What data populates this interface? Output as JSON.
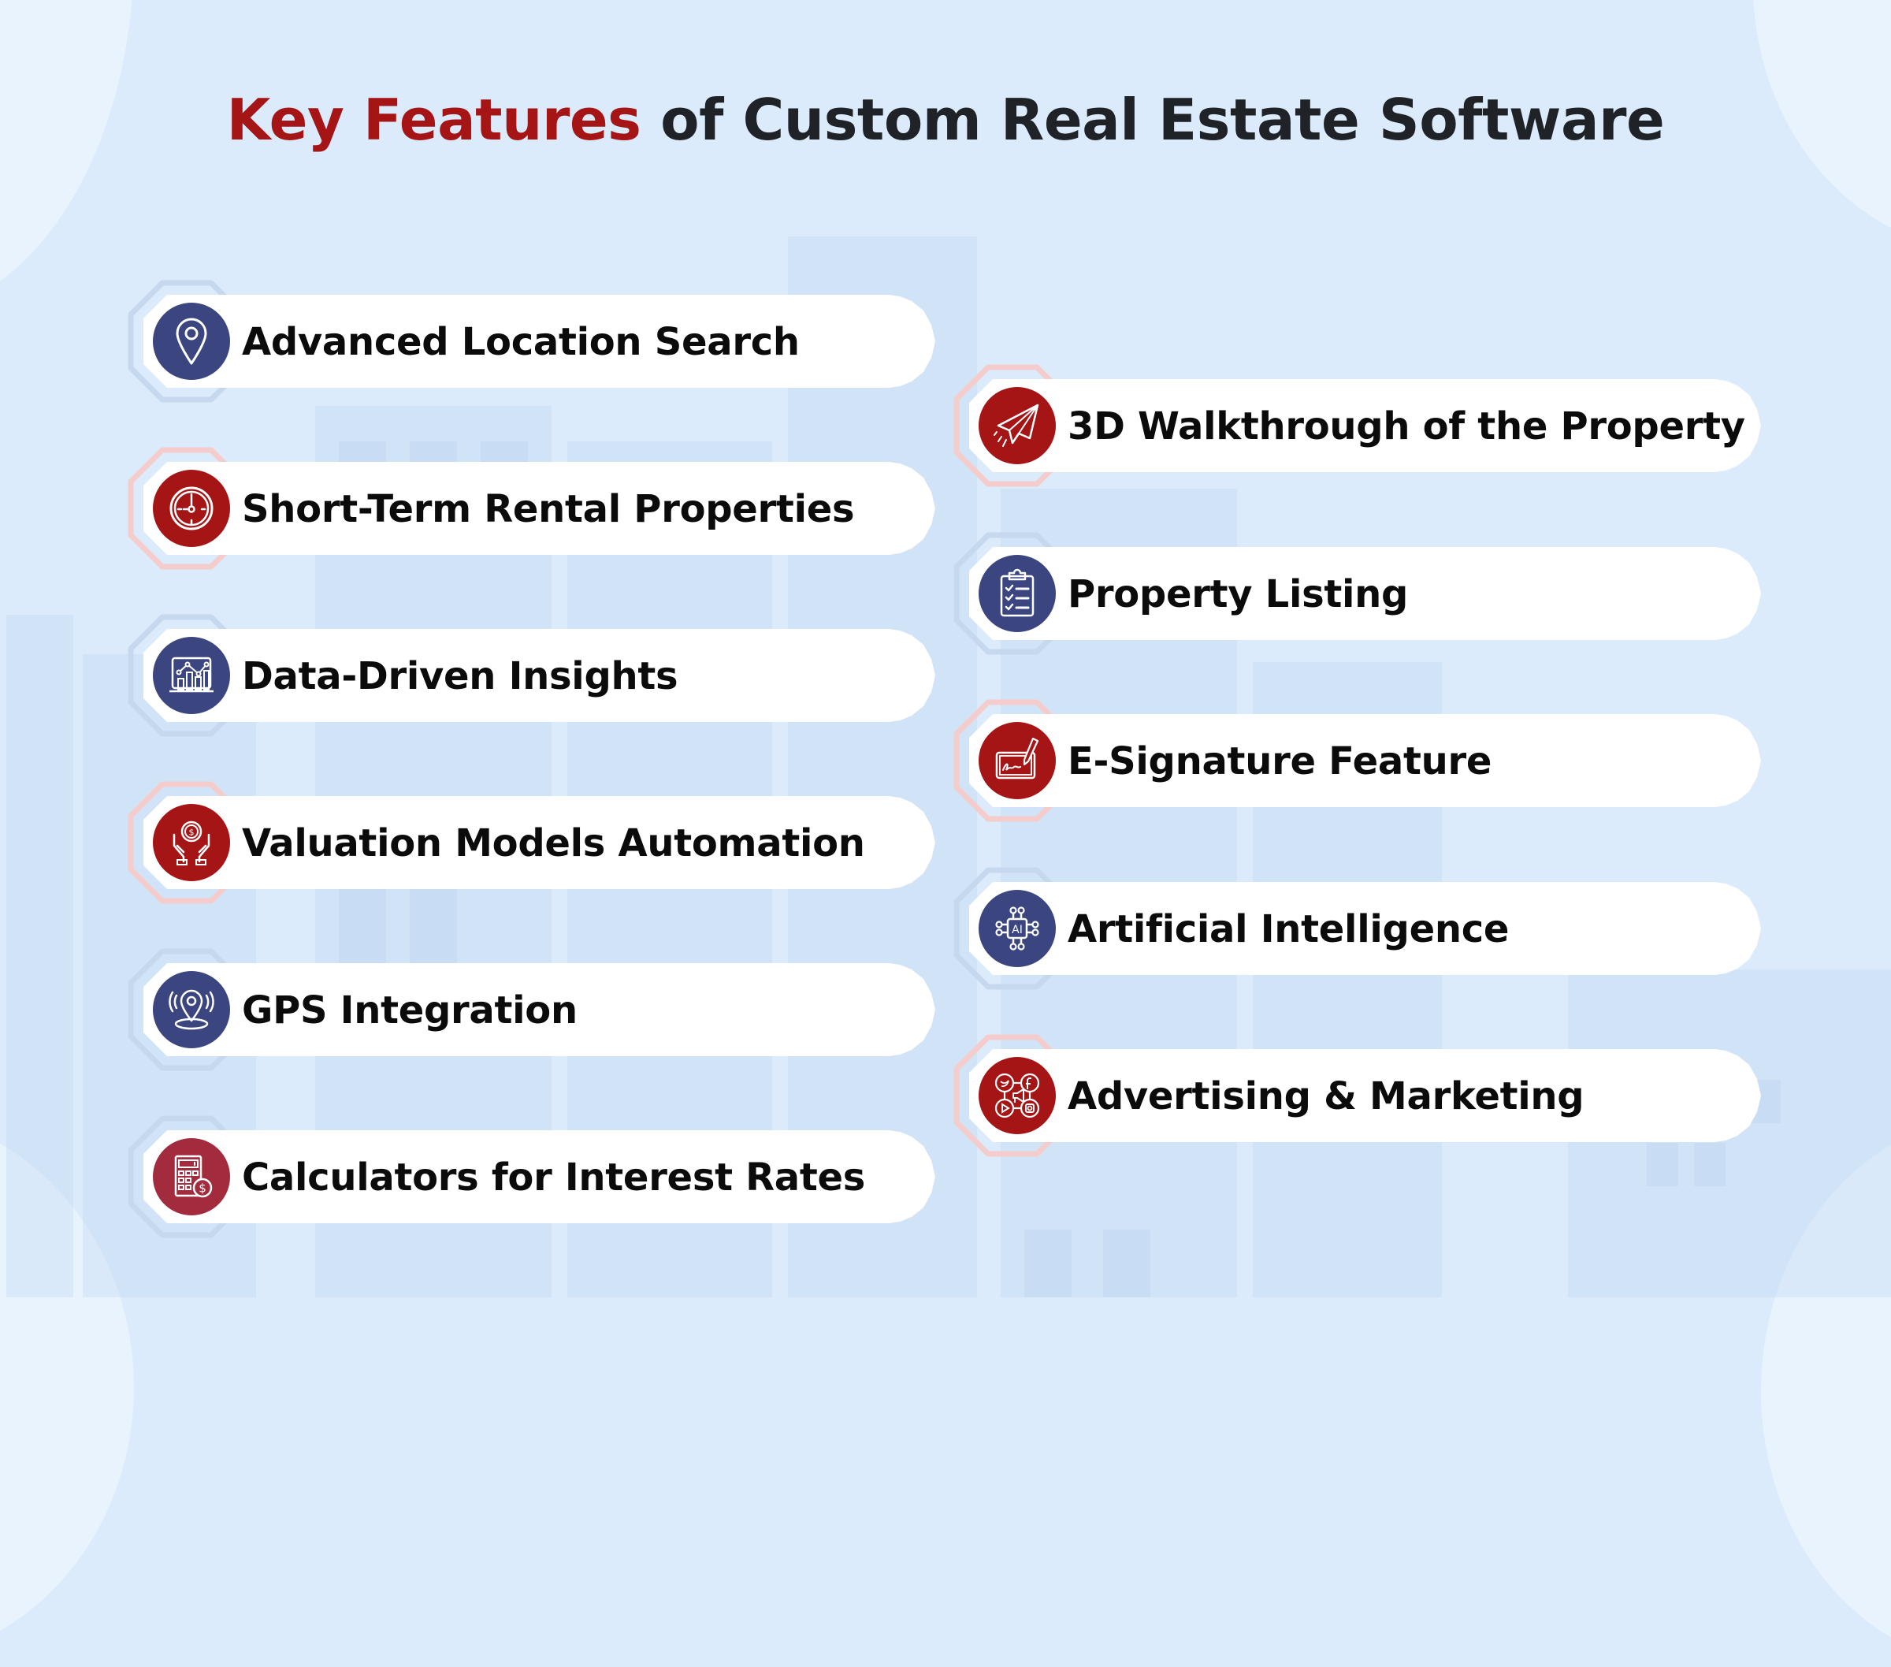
{
  "title": {
    "accent": "Key Features",
    "rest": " of Custom Real Estate Software"
  },
  "colors": {
    "accent_red": "#a51515",
    "navy": "#3b4580",
    "calculator_red": "#a22c3e",
    "hex_blue": "#c5d8ee",
    "hex_red": "#f4cccc",
    "background": "#dcebfb"
  },
  "features_left": [
    {
      "label": "Advanced Location Search",
      "icon": "map-pin-icon",
      "color": "navy"
    },
    {
      "label": "Short-Term Rental Properties",
      "icon": "clock-icon",
      "color": "red"
    },
    {
      "label": "Data-Driven Insights",
      "icon": "analytics-chart-icon",
      "color": "navy"
    },
    {
      "label": "Valuation Models Automation",
      "icon": "hands-coin-icon",
      "color": "red"
    },
    {
      "label": "GPS Integration",
      "icon": "gps-signal-pin-icon",
      "color": "navy"
    },
    {
      "label": "Calculators for Interest Rates",
      "icon": "calculator-dollar-icon",
      "color": "calculator_red"
    }
  ],
  "features_right": [
    {
      "label": "3D Walkthrough of the Property",
      "icon": "paper-plane-icon",
      "color": "red"
    },
    {
      "label": "Property Listing",
      "icon": "clipboard-checklist-icon",
      "color": "navy"
    },
    {
      "label": "E-Signature Feature",
      "icon": "e-signature-pen-icon",
      "color": "red"
    },
    {
      "label": "Artificial Intelligence",
      "icon": "ai-chip-icon",
      "color": "navy"
    },
    {
      "label": "Advertising & Marketing",
      "icon": "social-media-megaphone-icon",
      "color": "red"
    }
  ]
}
